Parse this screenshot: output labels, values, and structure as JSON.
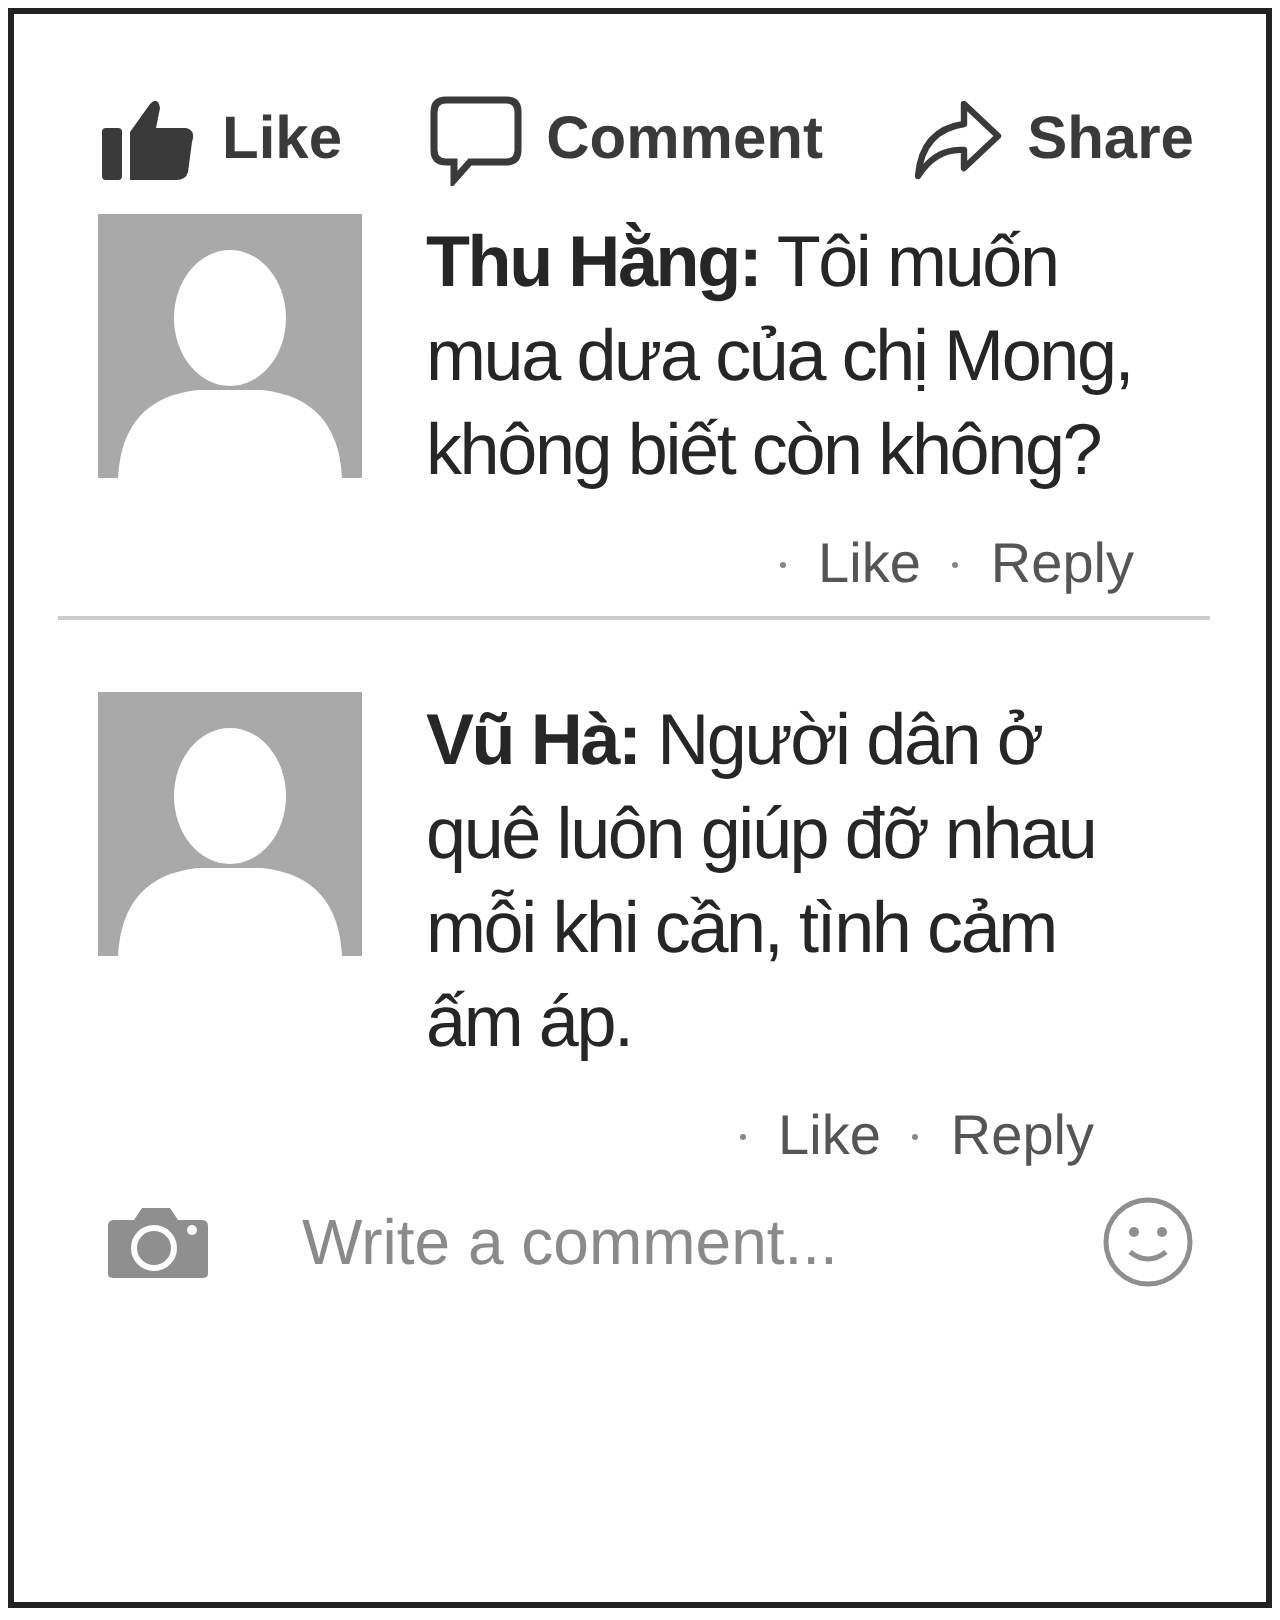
{
  "actions": [
    {
      "kind": "like",
      "label": "Like"
    },
    {
      "kind": "comment",
      "label": "Comment"
    },
    {
      "kind": "share",
      "label": "Share"
    }
  ],
  "comments": [
    {
      "text": "**Thu Hằng:** Tôi muốn mua dưa của chị Mong, không biết còn không?",
      "like": "Like",
      "reply": "Reply"
    },
    {
      "text": "**Vũ Hà:** Người dân ở quê luôn giúp đỡ nhau mỗi khi cần, tình cảm ấm áp.",
      "like": "Like",
      "reply": "Reply"
    }
  ],
  "composer": {
    "placeholder": "Write a comment..."
  }
}
